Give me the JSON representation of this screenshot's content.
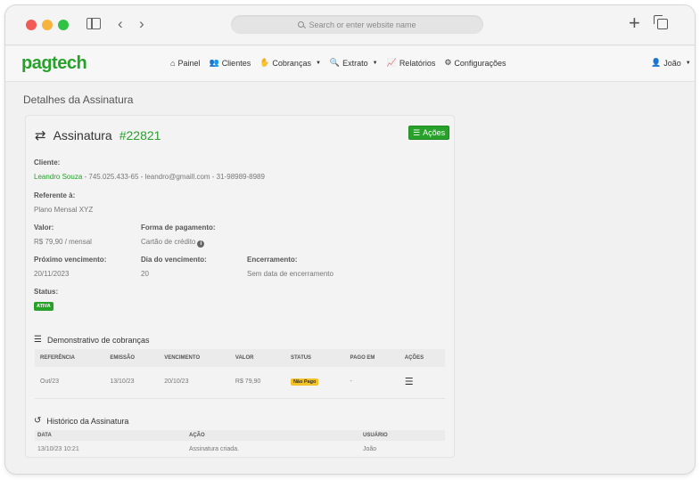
{
  "browser": {
    "url_placeholder": "Search or enter website name",
    "back_glyph": "‹",
    "forward_glyph": "›",
    "new_tab_glyph": "+"
  },
  "app": {
    "logo": "pagtech",
    "nav": [
      {
        "label": "Painel",
        "icon": "home-icon",
        "glyph": "⌂"
      },
      {
        "label": "Clientes",
        "icon": "users-icon",
        "glyph": "👥"
      },
      {
        "label": "Cobranças",
        "icon": "hand-coin-icon",
        "glyph": "✋",
        "dropdown": true
      },
      {
        "label": "Extrato",
        "icon": "search-dollar-icon",
        "glyph": "🔍",
        "dropdown": true
      },
      {
        "label": "Relatórios",
        "icon": "line-chart-icon",
        "glyph": "📈"
      },
      {
        "label": "Configurações",
        "icon": "gear-icon",
        "glyph": "⚙"
      }
    ],
    "user": {
      "name": "João",
      "icon": "user-icon",
      "glyph": "👤"
    }
  },
  "page": {
    "title": "Detalhes da Assinatura"
  },
  "subscription": {
    "heading": "Assinatura",
    "number": "#22821",
    "actions_label": "Ações",
    "cliente_label": "Cliente:",
    "cliente_name": "Leandro Souza",
    "cliente_details": " - 745.025.433-65 - leandro@gmaill.com - 31-98989-8989",
    "referente_label": "Referente à:",
    "referente_value": "Plano Mensal XYZ",
    "valor_label": "Valor:",
    "valor_value": "R$ 79,90 / mensal",
    "forma_label": "Forma de pagamento:",
    "forma_value": "Cartão de crédito",
    "proximo_label": "Próximo vencimento:",
    "proximo_value": "20/11/2023",
    "dia_label": "Dia do vencimento:",
    "dia_value": "20",
    "encerramento_label": "Encerramento:",
    "encerramento_value": "Sem data de encerramento",
    "status_label": "Status:",
    "status_value": "ATIVA"
  },
  "charges": {
    "title": "Demonstrativo de cobranças",
    "columns": [
      "REFERÊNCIA",
      "EMISSÃO",
      "VENCIMENTO",
      "VALOR",
      "STATUS",
      "PAGO EM",
      "AÇÕES"
    ],
    "rows": [
      {
        "referencia": "Out/23",
        "emissao": "13/10/23",
        "vencimento": "20/10/23",
        "valor": "R$ 79,90",
        "status": "Não Pago",
        "pago_em": "-"
      }
    ]
  },
  "history": {
    "title": "Histórico da Assinatura",
    "columns": [
      "DATA",
      "AÇÃO",
      "USUÁRIO"
    ],
    "rows": [
      {
        "data": "13/10/23 10:21",
        "acao": "Assinatura criada.",
        "usuario": "João"
      }
    ]
  },
  "colors": {
    "brand": "#27a12a",
    "warning": "#f3c229"
  }
}
